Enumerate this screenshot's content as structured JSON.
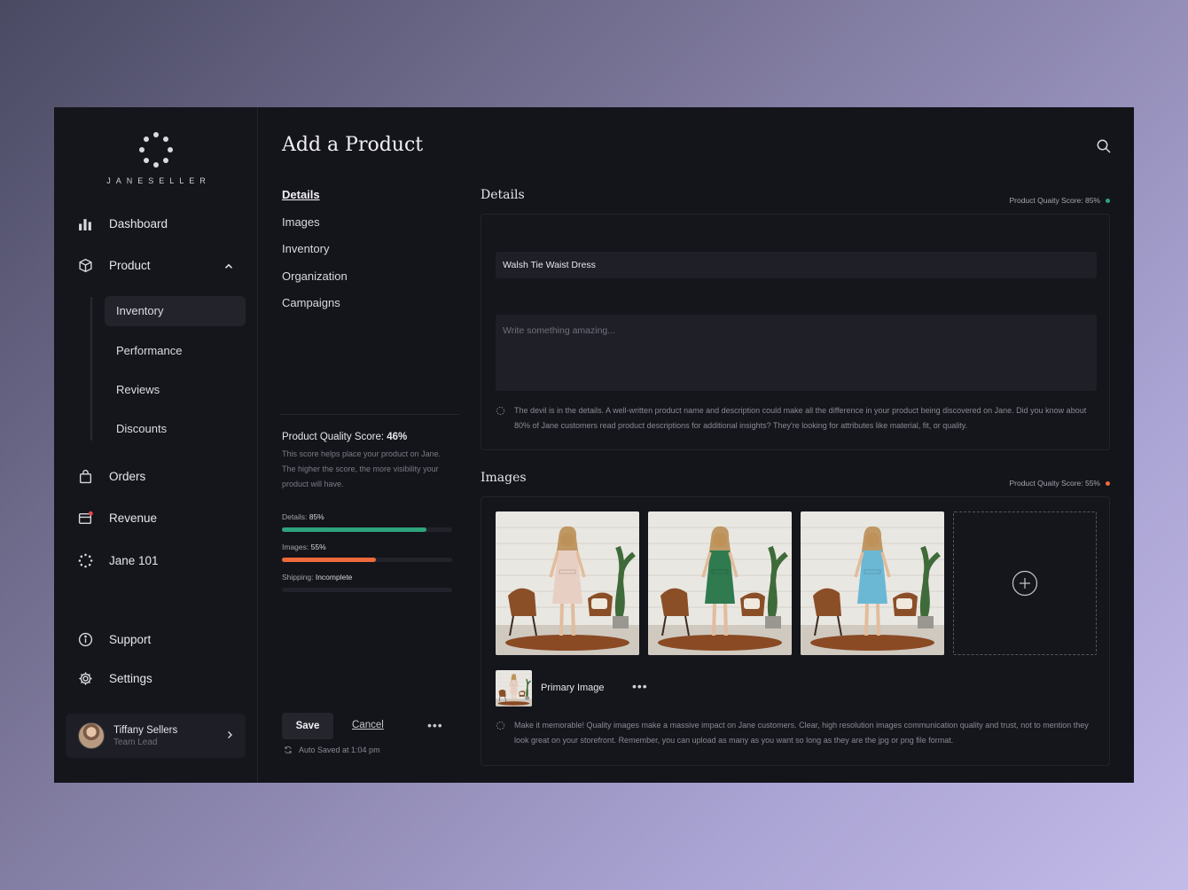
{
  "app": {
    "brand": "JANESELLER",
    "page_title": "Add a Product"
  },
  "sidebar": {
    "items": [
      {
        "label": "Dashboard",
        "icon": "bar-chart-icon"
      },
      {
        "label": "Product",
        "icon": "box-icon"
      },
      {
        "label": "Orders",
        "icon": "bag-icon"
      },
      {
        "label": "Revenue",
        "icon": "wallet-icon"
      },
      {
        "label": "Jane 101",
        "icon": "jane-logo-icon"
      },
      {
        "label": "Support",
        "icon": "info-icon"
      },
      {
        "label": "Settings",
        "icon": "gear-icon"
      }
    ],
    "product_sub": [
      "Inventory",
      "Performance",
      "Reviews",
      "Discounts"
    ],
    "active_sub": "Inventory",
    "revenue_badge_color": "#e5484d",
    "user": {
      "name": "Tiffany Sellers",
      "role": "Team Lead"
    }
  },
  "subnav": {
    "items": [
      "Details",
      "Images",
      "Inventory",
      "Organization",
      "Campaigns"
    ],
    "active": "Details"
  },
  "score": {
    "title_label": "Product Quality Score:",
    "value": "46%",
    "description": "This score helps place your product on Jane. The higher the score, the more visibility your product will have.",
    "bars": [
      {
        "label": "Details:",
        "value_text": "85%",
        "fraction": 0.85,
        "color": "#2fa37c"
      },
      {
        "label": "Images:",
        "value_text": "55%",
        "fraction": 0.55,
        "color": "#ee6a3a"
      },
      {
        "label": "Shipping:",
        "value_text": "Incomplete",
        "fraction": 0,
        "color": "#2fa37c"
      }
    ]
  },
  "actions": {
    "save": "Save",
    "cancel": "Cancel",
    "more": "•••",
    "autosave": "Auto Saved at 1:04 pm"
  },
  "details": {
    "title": "Details",
    "quality": "Product Quaity Score: 85%",
    "quality_color": "#2fa37c",
    "name_value": "Walsh Tie Waist Dress",
    "description_placeholder": "Write something amazing...",
    "tip": "The devil is in the details. A well-written product name and description could make all the difference in your product being discovered on Jane. Did you know about 80% of Jane customers read product descriptions for additional insights? They're looking for attributes like material, fit, or quality."
  },
  "images": {
    "title": "Images",
    "quality": "Product Quaity Score: 55%",
    "quality_color": "#ee6a3a",
    "photos": [
      {
        "dress_color": "#e8cfc3"
      },
      {
        "dress_color": "#2f7a4f"
      },
      {
        "dress_color": "#6bb8d4"
      }
    ],
    "primary_label": "Primary Image",
    "more": "•••",
    "tip": "Make it memorable! Quality images make a massive impact on Jane customers. Clear, high resolution images communication quality and trust, not to mention they look great on your storefront. Remember, you can upload as many as you want so long as they are the jpg or png file format."
  }
}
